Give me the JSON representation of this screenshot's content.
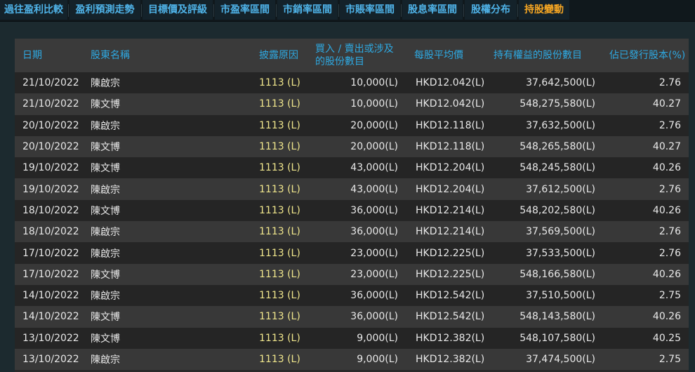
{
  "tabs": [
    {
      "label": "過往盈利比較",
      "active": false
    },
    {
      "label": "盈利預測走勢",
      "active": false
    },
    {
      "label": "目標價及評級",
      "active": false
    },
    {
      "label": "市盈率區間",
      "active": false
    },
    {
      "label": "市銷率區間",
      "active": false
    },
    {
      "label": "市賬率區間",
      "active": false
    },
    {
      "label": "股息率區間",
      "active": false
    },
    {
      "label": "股權分布",
      "active": false
    },
    {
      "label": "持股變動",
      "active": true
    }
  ],
  "table": {
    "headers": {
      "date": "日期",
      "holder": "股東名稱",
      "reason": "披露原因",
      "shares_line1": "買入 / 賣出或涉及",
      "shares_line2": "的股份數目",
      "avg_price": "每股平均價",
      "holding": "持有權益的股份數目",
      "pct": "佔已發行股本(%)"
    },
    "rows": [
      {
        "date": "21/10/2022",
        "holder": "陳啟宗",
        "reason": "1113 (L)",
        "shares": "10,000(L)",
        "price": "HKD12.042(L)",
        "holding": "37,642,500(L)",
        "pct": "2.76"
      },
      {
        "date": "21/10/2022",
        "holder": "陳文博",
        "reason": "1113 (L)",
        "shares": "10,000(L)",
        "price": "HKD12.042(L)",
        "holding": "548,275,580(L)",
        "pct": "40.27"
      },
      {
        "date": "20/10/2022",
        "holder": "陳啟宗",
        "reason": "1113 (L)",
        "shares": "20,000(L)",
        "price": "HKD12.118(L)",
        "holding": "37,632,500(L)",
        "pct": "2.76"
      },
      {
        "date": "20/10/2022",
        "holder": "陳文博",
        "reason": "1113 (L)",
        "shares": "20,000(L)",
        "price": "HKD12.118(L)",
        "holding": "548,265,580(L)",
        "pct": "40.27"
      },
      {
        "date": "19/10/2022",
        "holder": "陳文博",
        "reason": "1113 (L)",
        "shares": "43,000(L)",
        "price": "HKD12.204(L)",
        "holding": "548,245,580(L)",
        "pct": "40.26"
      },
      {
        "date": "19/10/2022",
        "holder": "陳啟宗",
        "reason": "1113 (L)",
        "shares": "43,000(L)",
        "price": "HKD12.204(L)",
        "holding": "37,612,500(L)",
        "pct": "2.76"
      },
      {
        "date": "18/10/2022",
        "holder": "陳文博",
        "reason": "1113 (L)",
        "shares": "36,000(L)",
        "price": "HKD12.214(L)",
        "holding": "548,202,580(L)",
        "pct": "40.26"
      },
      {
        "date": "18/10/2022",
        "holder": "陳啟宗",
        "reason": "1113 (L)",
        "shares": "36,000(L)",
        "price": "HKD12.214(L)",
        "holding": "37,569,500(L)",
        "pct": "2.76"
      },
      {
        "date": "17/10/2022",
        "holder": "陳啟宗",
        "reason": "1113 (L)",
        "shares": "23,000(L)",
        "price": "HKD12.225(L)",
        "holding": "37,533,500(L)",
        "pct": "2.76"
      },
      {
        "date": "17/10/2022",
        "holder": "陳文博",
        "reason": "1113 (L)",
        "shares": "23,000(L)",
        "price": "HKD12.225(L)",
        "holding": "548,166,580(L)",
        "pct": "40.26"
      },
      {
        "date": "14/10/2022",
        "holder": "陳啟宗",
        "reason": "1113 (L)",
        "shares": "36,000(L)",
        "price": "HKD12.542(L)",
        "holding": "37,510,500(L)",
        "pct": "2.75"
      },
      {
        "date": "14/10/2022",
        "holder": "陳文博",
        "reason": "1113 (L)",
        "shares": "36,000(L)",
        "price": "HKD12.542(L)",
        "holding": "548,143,580(L)",
        "pct": "40.26"
      },
      {
        "date": "13/10/2022",
        "holder": "陳文博",
        "reason": "1113 (L)",
        "shares": "9,000(L)",
        "price": "HKD12.382(L)",
        "holding": "548,107,580(L)",
        "pct": "40.25"
      },
      {
        "date": "13/10/2022",
        "holder": "陳啟宗",
        "reason": "1113 (L)",
        "shares": "9,000(L)",
        "price": "HKD12.382(L)",
        "holding": "37,474,500(L)",
        "pct": "2.75"
      }
    ]
  }
}
